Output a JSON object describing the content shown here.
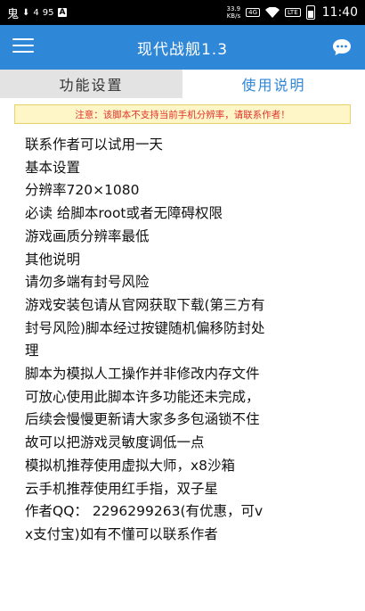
{
  "status_bar": {
    "left_icon_text": "鬼",
    "left_small": "4",
    "left_small2": "95",
    "left_box": "A",
    "net_speed_top": "33.9",
    "net_speed_bottom": "KB/s",
    "net_badge": "4G",
    "net_badge2": "LTE",
    "battery_level": 0.6,
    "time": "11:40"
  },
  "app_bar": {
    "title": "现代战舰1.3"
  },
  "tabs": [
    {
      "label": "功能设置",
      "active": false
    },
    {
      "label": "使用说明",
      "active": true
    }
  ],
  "notice": "注意：该脚本不支持当前手机分辨率，请联系作者！",
  "content_lines": [
    "联系作者可以试用一天",
    "基本设置",
    "分辨率720×1080",
    "必读 给脚本root或者无障碍权限",
    "游戏画质分辨率最低",
    "其他说明",
    "请勿多端有封号风险",
    "游戏安装包请从官网获取下载(第三方有",
    "封号风险)脚本经过按键随机偏移防封处",
    "理",
    "脚本为模拟人工操作并非修改内存文件",
    "可放心使用此脚本许多功能还未完成，",
    "后续会慢慢更新请大家多多包涵锁不住",
    "故可以把游戏灵敏度调低一点",
    "模拟机推荐使用虚拟大师，x8沙箱",
    "云手机推荐使用红手指，双子星",
    "作者QQ： 2296299263(有优惠，可v",
    "x支付宝)如有不懂可以联系作者"
  ],
  "colors": {
    "app_bar": "#2f87d7",
    "tab_inactive_bg": "#e3e3e3",
    "notice_bg": "#fff6c8",
    "notice_text": "#e0332b"
  },
  "icons": {
    "menu": "hamburger-menu-icon",
    "chat": "chat-bubble-icon"
  }
}
